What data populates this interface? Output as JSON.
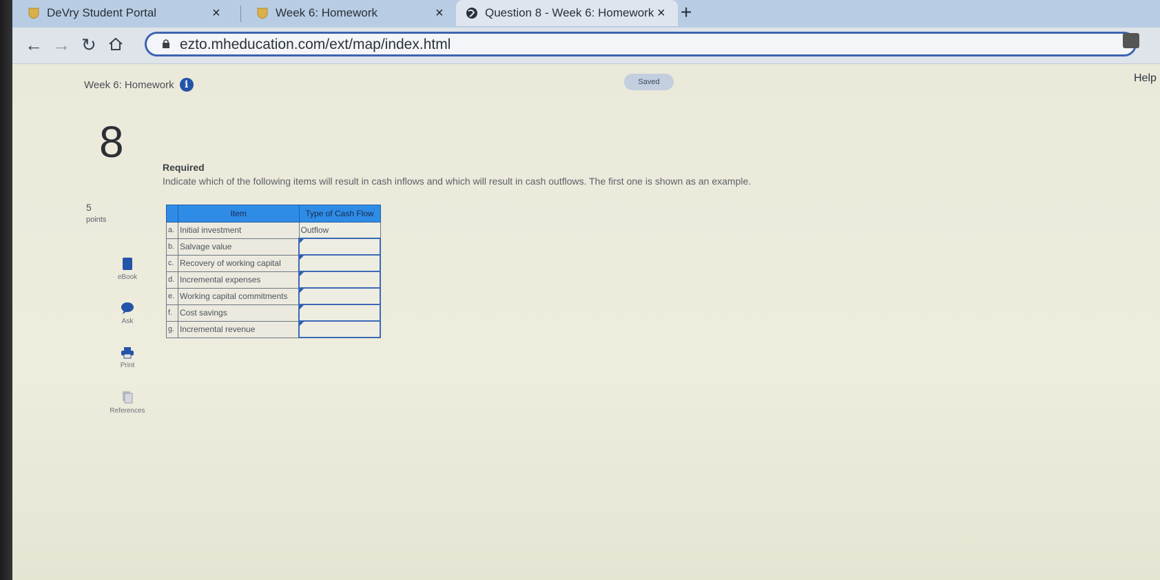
{
  "tabs": [
    {
      "title": "DeVry Student Portal",
      "close": "×"
    },
    {
      "title": "Week 6: Homework",
      "close": "×"
    },
    {
      "title": "Question 8 - Week 6: Homework",
      "close": "×"
    }
  ],
  "new_tab_symbol": "+",
  "address_bar": {
    "url": "ezto.mheducation.com/ext/map/index.html"
  },
  "header": {
    "assignment_title": "Week 6: Homework",
    "saved_label": "Saved",
    "help_label": "Help"
  },
  "question": {
    "number": "8",
    "points_value": "5",
    "points_label": "points",
    "required_label": "Required",
    "instructions": "Indicate which of the following items will result in cash inflows and which will result in cash outflows. The first one is shown as an example."
  },
  "sidebar": {
    "items": [
      {
        "label": "eBook",
        "icon": "book-icon"
      },
      {
        "label": "Ask",
        "icon": "chat-bubble-icon"
      },
      {
        "label": "Print",
        "icon": "printer-icon"
      },
      {
        "label": "References",
        "icon": "documents-icon"
      }
    ]
  },
  "table": {
    "headers": {
      "item": "Item",
      "type": "Type of Cash Flow"
    },
    "rows": [
      {
        "letter": "a.",
        "item": "Initial investment",
        "value": "Outflow"
      },
      {
        "letter": "b.",
        "item": "Salvage value",
        "value": ""
      },
      {
        "letter": "c.",
        "item": "Recovery of working capital",
        "value": ""
      },
      {
        "letter": "d.",
        "item": "Incremental expenses",
        "value": ""
      },
      {
        "letter": "e.",
        "item": "Working capital commitments",
        "value": ""
      },
      {
        "letter": "f.",
        "item": "Cost savings",
        "value": ""
      },
      {
        "letter": "g.",
        "item": "Incremental revenue",
        "value": ""
      }
    ]
  },
  "colors": {
    "accent": "#2f8ce6",
    "info": "#2454a8",
    "omnibox_border": "#3d63b0"
  }
}
